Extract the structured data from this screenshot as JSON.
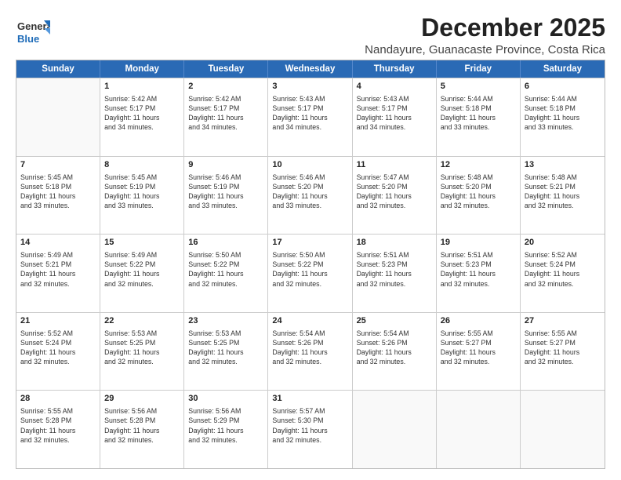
{
  "header": {
    "logo_line1": "General",
    "logo_line2": "Blue",
    "title": "December 2025",
    "subtitle": "Nandayure, Guanacaste Province, Costa Rica"
  },
  "calendar": {
    "weekdays": [
      "Sunday",
      "Monday",
      "Tuesday",
      "Wednesday",
      "Thursday",
      "Friday",
      "Saturday"
    ],
    "rows": [
      [
        {
          "day": "",
          "lines": []
        },
        {
          "day": "1",
          "lines": [
            "Sunrise: 5:42 AM",
            "Sunset: 5:17 PM",
            "Daylight: 11 hours",
            "and 34 minutes."
          ]
        },
        {
          "day": "2",
          "lines": [
            "Sunrise: 5:42 AM",
            "Sunset: 5:17 PM",
            "Daylight: 11 hours",
            "and 34 minutes."
          ]
        },
        {
          "day": "3",
          "lines": [
            "Sunrise: 5:43 AM",
            "Sunset: 5:17 PM",
            "Daylight: 11 hours",
            "and 34 minutes."
          ]
        },
        {
          "day": "4",
          "lines": [
            "Sunrise: 5:43 AM",
            "Sunset: 5:17 PM",
            "Daylight: 11 hours",
            "and 34 minutes."
          ]
        },
        {
          "day": "5",
          "lines": [
            "Sunrise: 5:44 AM",
            "Sunset: 5:18 PM",
            "Daylight: 11 hours",
            "and 33 minutes."
          ]
        },
        {
          "day": "6",
          "lines": [
            "Sunrise: 5:44 AM",
            "Sunset: 5:18 PM",
            "Daylight: 11 hours",
            "and 33 minutes."
          ]
        }
      ],
      [
        {
          "day": "7",
          "lines": [
            "Sunrise: 5:45 AM",
            "Sunset: 5:18 PM",
            "Daylight: 11 hours",
            "and 33 minutes."
          ]
        },
        {
          "day": "8",
          "lines": [
            "Sunrise: 5:45 AM",
            "Sunset: 5:19 PM",
            "Daylight: 11 hours",
            "and 33 minutes."
          ]
        },
        {
          "day": "9",
          "lines": [
            "Sunrise: 5:46 AM",
            "Sunset: 5:19 PM",
            "Daylight: 11 hours",
            "and 33 minutes."
          ]
        },
        {
          "day": "10",
          "lines": [
            "Sunrise: 5:46 AM",
            "Sunset: 5:20 PM",
            "Daylight: 11 hours",
            "and 33 minutes."
          ]
        },
        {
          "day": "11",
          "lines": [
            "Sunrise: 5:47 AM",
            "Sunset: 5:20 PM",
            "Daylight: 11 hours",
            "and 32 minutes."
          ]
        },
        {
          "day": "12",
          "lines": [
            "Sunrise: 5:48 AM",
            "Sunset: 5:20 PM",
            "Daylight: 11 hours",
            "and 32 minutes."
          ]
        },
        {
          "day": "13",
          "lines": [
            "Sunrise: 5:48 AM",
            "Sunset: 5:21 PM",
            "Daylight: 11 hours",
            "and 32 minutes."
          ]
        }
      ],
      [
        {
          "day": "14",
          "lines": [
            "Sunrise: 5:49 AM",
            "Sunset: 5:21 PM",
            "Daylight: 11 hours",
            "and 32 minutes."
          ]
        },
        {
          "day": "15",
          "lines": [
            "Sunrise: 5:49 AM",
            "Sunset: 5:22 PM",
            "Daylight: 11 hours",
            "and 32 minutes."
          ]
        },
        {
          "day": "16",
          "lines": [
            "Sunrise: 5:50 AM",
            "Sunset: 5:22 PM",
            "Daylight: 11 hours",
            "and 32 minutes."
          ]
        },
        {
          "day": "17",
          "lines": [
            "Sunrise: 5:50 AM",
            "Sunset: 5:22 PM",
            "Daylight: 11 hours",
            "and 32 minutes."
          ]
        },
        {
          "day": "18",
          "lines": [
            "Sunrise: 5:51 AM",
            "Sunset: 5:23 PM",
            "Daylight: 11 hours",
            "and 32 minutes."
          ]
        },
        {
          "day": "19",
          "lines": [
            "Sunrise: 5:51 AM",
            "Sunset: 5:23 PM",
            "Daylight: 11 hours",
            "and 32 minutes."
          ]
        },
        {
          "day": "20",
          "lines": [
            "Sunrise: 5:52 AM",
            "Sunset: 5:24 PM",
            "Daylight: 11 hours",
            "and 32 minutes."
          ]
        }
      ],
      [
        {
          "day": "21",
          "lines": [
            "Sunrise: 5:52 AM",
            "Sunset: 5:24 PM",
            "Daylight: 11 hours",
            "and 32 minutes."
          ]
        },
        {
          "day": "22",
          "lines": [
            "Sunrise: 5:53 AM",
            "Sunset: 5:25 PM",
            "Daylight: 11 hours",
            "and 32 minutes."
          ]
        },
        {
          "day": "23",
          "lines": [
            "Sunrise: 5:53 AM",
            "Sunset: 5:25 PM",
            "Daylight: 11 hours",
            "and 32 minutes."
          ]
        },
        {
          "day": "24",
          "lines": [
            "Sunrise: 5:54 AM",
            "Sunset: 5:26 PM",
            "Daylight: 11 hours",
            "and 32 minutes."
          ]
        },
        {
          "day": "25",
          "lines": [
            "Sunrise: 5:54 AM",
            "Sunset: 5:26 PM",
            "Daylight: 11 hours",
            "and 32 minutes."
          ]
        },
        {
          "day": "26",
          "lines": [
            "Sunrise: 5:55 AM",
            "Sunset: 5:27 PM",
            "Daylight: 11 hours",
            "and 32 minutes."
          ]
        },
        {
          "day": "27",
          "lines": [
            "Sunrise: 5:55 AM",
            "Sunset: 5:27 PM",
            "Daylight: 11 hours",
            "and 32 minutes."
          ]
        }
      ],
      [
        {
          "day": "28",
          "lines": [
            "Sunrise: 5:55 AM",
            "Sunset: 5:28 PM",
            "Daylight: 11 hours",
            "and 32 minutes."
          ]
        },
        {
          "day": "29",
          "lines": [
            "Sunrise: 5:56 AM",
            "Sunset: 5:28 PM",
            "Daylight: 11 hours",
            "and 32 minutes."
          ]
        },
        {
          "day": "30",
          "lines": [
            "Sunrise: 5:56 AM",
            "Sunset: 5:29 PM",
            "Daylight: 11 hours",
            "and 32 minutes."
          ]
        },
        {
          "day": "31",
          "lines": [
            "Sunrise: 5:57 AM",
            "Sunset: 5:30 PM",
            "Daylight: 11 hours",
            "and 32 minutes."
          ]
        },
        {
          "day": "",
          "lines": []
        },
        {
          "day": "",
          "lines": []
        },
        {
          "day": "",
          "lines": []
        }
      ]
    ]
  }
}
